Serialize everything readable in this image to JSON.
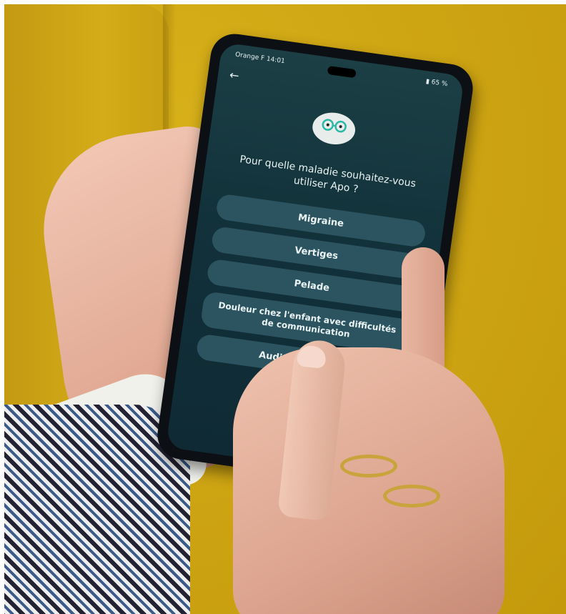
{
  "phone": {
    "status_left": "Orange F 14:01",
    "status_right": "65 %",
    "back_icon": "arrow-left-icon",
    "question": "Pour quelle maladie souhaitez-vous utiliser Apo ?",
    "options": [
      "Migraine",
      "Vertiges",
      "Pelade",
      "Douleur chez l'enfant avec difficultés de communication",
      "Audition - e... te"
    ]
  },
  "colors": {
    "background": "#cfa614",
    "screen": "#12313a",
    "option_button": "#2c5360"
  }
}
